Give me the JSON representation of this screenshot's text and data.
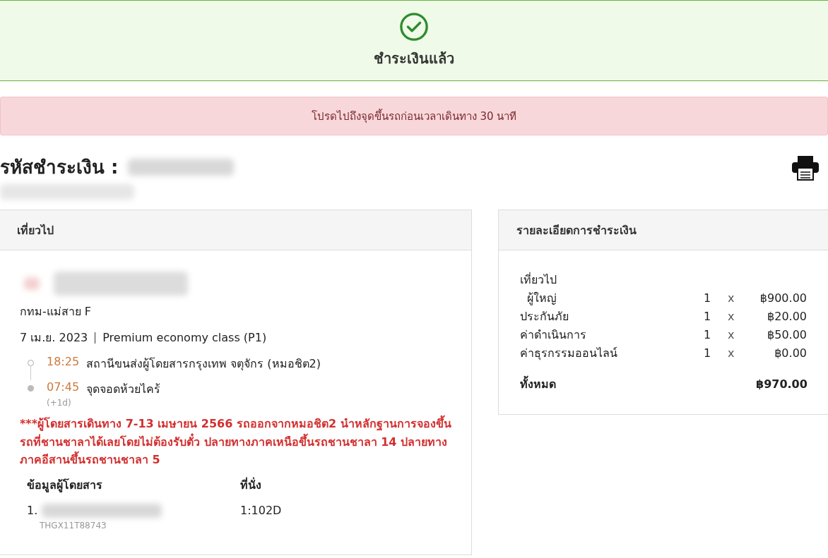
{
  "status": {
    "title": "ชำระเงินแล้ว",
    "paid": true
  },
  "notice": "โปรดไปถึงจุดขึ้นรถก่อนเวลาเดินทาง 30 นาที",
  "payment": {
    "label": "รหัสชำระเงิน :"
  },
  "trip": {
    "header": "เที่ยวไป",
    "route": "กทม-แม่สาย F",
    "date": "7 เม.ย. 2023",
    "class": "Premium economy class (P1)",
    "stops": [
      {
        "kind": "departure",
        "time": "18:25",
        "place": "สถานีขนส่งผู้โดยสารกรุงเทพ จตุจักร (หมอชิต2)"
      },
      {
        "kind": "arrival",
        "time": "07:45",
        "place": "จุดจอดห้วยไคร้",
        "day_offset": "(+1d)"
      }
    ],
    "warning": "***ผู้โดยสารเดินทาง 7-13 เมษายน 2566 รถออกจากหมอชิต2 นำหลักฐานการจองขึ้นรถที่ชานชาลาได้เลยโดยไม่ต้องรับตั๋ว ปลายทางภาคเหนือขึ้นรถชานชาลา 14 ปลายทางภาคอีสานขึ้นรถชานชาลา 5",
    "passenger_columns": [
      "ข้อมูลผู้โดยสาร",
      "ที่นั่ง"
    ],
    "passengers": [
      {
        "number": "1.",
        "code": "THGX11T88743",
        "seat": "1:102D"
      }
    ]
  },
  "summary": {
    "header": "รายละเอียดการชำระเงิน",
    "section": "เที่ยวไป",
    "items": [
      {
        "name": "ผู้ใหญ่",
        "indented": true,
        "qty": "1",
        "times": "x",
        "amount": "฿900.00"
      },
      {
        "name": "ประกันภัย",
        "indented": false,
        "qty": "1",
        "times": "x",
        "amount": "฿20.00"
      },
      {
        "name": "ค่าดำเนินการ",
        "indented": false,
        "qty": "1",
        "times": "x",
        "amount": "฿50.00"
      },
      {
        "name": "ค่าธุรกรรมออนไลน์",
        "indented": false,
        "qty": "1",
        "times": "x",
        "amount": "฿0.00"
      }
    ],
    "total_label": "ทั้งหมด",
    "total": "฿970.00"
  }
}
